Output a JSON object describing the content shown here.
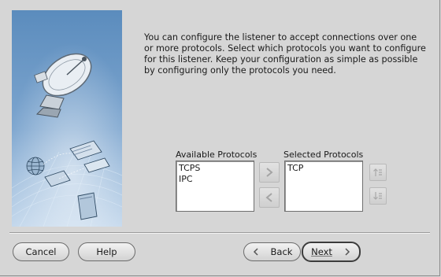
{
  "intro_text": "You can configure the listener to accept connections over one or more protocols. Select which protocols you want to configure for this listener. Keep your configuration as simple as possible by configuring only the protocols you need.",
  "available": {
    "label": "Available Protocols",
    "items": [
      "TCPS",
      "IPC"
    ]
  },
  "selected": {
    "label": "Selected Protocols",
    "items": [
      "TCP"
    ]
  },
  "buttons": {
    "cancel": "Cancel",
    "help": "Help",
    "back": "Back",
    "next": "Next"
  },
  "icons": {
    "add": "right-arrow-icon",
    "remove": "left-arrow-icon",
    "move_up": "move-up-icon",
    "move_down": "move-down-icon",
    "back": "chevron-left-icon",
    "next": "chevron-right-icon"
  },
  "colors": {
    "panel_bg": "#d6d6d6",
    "side_image_top": "#5f8fc0",
    "side_image_bottom": "#bcd3ea"
  }
}
